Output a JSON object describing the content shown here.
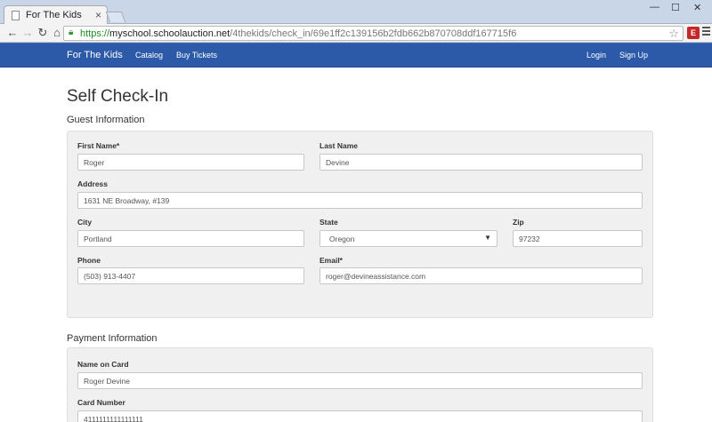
{
  "browser": {
    "tab_title": "For The Kids",
    "tab_close": "×",
    "url_scheme": "https://",
    "url_host": "myschool.schoolauction.net",
    "url_path": "/4thekids/check_in/69e1ff2c139156b2fdb662b870708ddf167715f6",
    "minimize": "—",
    "maximize": "☐",
    "close": "✕"
  },
  "nav": {
    "brand": "For The Kids",
    "catalog": "Catalog",
    "buy_tickets": "Buy Tickets",
    "login": "Login",
    "signup": "Sign Up"
  },
  "page": {
    "title": "Self Check-In",
    "guest_section": "Guest Information",
    "payment_section": "Payment Information"
  },
  "guest": {
    "first_name": {
      "label": "First Name*",
      "value": "Roger"
    },
    "last_name": {
      "label": "Last Name",
      "value": "Devine"
    },
    "address": {
      "label": "Address",
      "value": "1631 NE Broadway, #139"
    },
    "city": {
      "label": "City",
      "value": "Portland"
    },
    "state": {
      "label": "State",
      "value": "Oregon"
    },
    "zip": {
      "label": "Zip",
      "value": "97232"
    },
    "phone": {
      "label": "Phone",
      "value": "(503) 913-4407"
    },
    "email": {
      "label": "Email*",
      "value": "roger@devineassistance.com"
    }
  },
  "payment": {
    "name_on_card": {
      "label": "Name on Card",
      "value": "Roger Devine"
    },
    "card_number": {
      "label": "Card Number",
      "value": "4111111111111111"
    }
  },
  "colors": {
    "navbar": "#2c5aa8",
    "well": "#f0f0f0"
  }
}
